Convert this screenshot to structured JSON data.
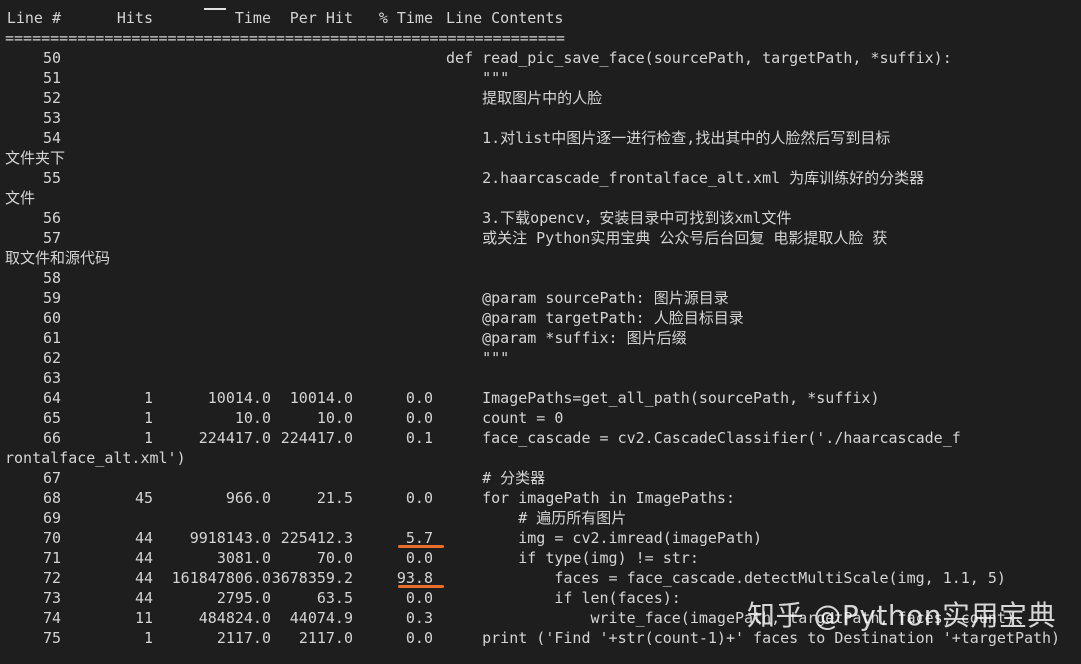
{
  "header": {
    "line_no": "Line #",
    "hits": "Hits",
    "time": "Time",
    "per_hit": "Per Hit",
    "pct_time": "% Time",
    "contents": "Line Contents"
  },
  "separator": "==============================================================",
  "rows": [
    {
      "ln": "50",
      "hits": "",
      "time": "",
      "per_hit": "",
      "pct": "",
      "content": "def read_pic_save_face(sourcePath, targetPath, *suffix):",
      "wrap": ""
    },
    {
      "ln": "51",
      "hits": "",
      "time": "",
      "per_hit": "",
      "pct": "",
      "content": "    \"\"\"",
      "wrap": ""
    },
    {
      "ln": "52",
      "hits": "",
      "time": "",
      "per_hit": "",
      "pct": "",
      "content": "    提取图片中的人脸",
      "wrap": ""
    },
    {
      "ln": "53",
      "hits": "",
      "time": "",
      "per_hit": "",
      "pct": "",
      "content": "",
      "wrap": ""
    },
    {
      "ln": "54",
      "hits": "",
      "time": "",
      "per_hit": "",
      "pct": "",
      "content": "    1.对list中图片逐一进行检查,找出其中的人脸然后写到目标",
      "wrap": "文件夹下"
    },
    {
      "ln": "55",
      "hits": "",
      "time": "",
      "per_hit": "",
      "pct": "",
      "content": "    2.haarcascade_frontalface_alt.xml 为库训练好的分类器",
      "wrap": "文件"
    },
    {
      "ln": "56",
      "hits": "",
      "time": "",
      "per_hit": "",
      "pct": "",
      "content": "    3.下载opencv，安装目录中可找到该xml文件",
      "wrap": ""
    },
    {
      "ln": "57",
      "hits": "",
      "time": "",
      "per_hit": "",
      "pct": "",
      "content": "    或关注 Python实用宝典 公众号后台回复 电影提取人脸 获",
      "wrap": "取文件和源代码"
    },
    {
      "ln": "58",
      "hits": "",
      "time": "",
      "per_hit": "",
      "pct": "",
      "content": "",
      "wrap": ""
    },
    {
      "ln": "59",
      "hits": "",
      "time": "",
      "per_hit": "",
      "pct": "",
      "content": "    @param sourcePath: 图片源目录",
      "wrap": ""
    },
    {
      "ln": "60",
      "hits": "",
      "time": "",
      "per_hit": "",
      "pct": "",
      "content": "    @param targetPath: 人脸目标目录",
      "wrap": ""
    },
    {
      "ln": "61",
      "hits": "",
      "time": "",
      "per_hit": "",
      "pct": "",
      "content": "    @param *suffix: 图片后缀",
      "wrap": ""
    },
    {
      "ln": "62",
      "hits": "",
      "time": "",
      "per_hit": "",
      "pct": "",
      "content": "    \"\"\"",
      "wrap": ""
    },
    {
      "ln": "63",
      "hits": "",
      "time": "",
      "per_hit": "",
      "pct": "",
      "content": "",
      "wrap": ""
    },
    {
      "ln": "64",
      "hits": "1",
      "time": "10014.0",
      "per_hit": "10014.0",
      "pct": "0.0",
      "content": "    ImagePaths=get_all_path(sourcePath, *suffix)",
      "wrap": ""
    },
    {
      "ln": "65",
      "hits": "1",
      "time": "10.0",
      "per_hit": "10.0",
      "pct": "0.0",
      "content": "    count = 0",
      "wrap": ""
    },
    {
      "ln": "66",
      "hits": "1",
      "time": "224417.0",
      "per_hit": "224417.0",
      "pct": "0.1",
      "content": "    face_cascade = cv2.CascadeClassifier('./haarcascade_f",
      "wrap": "rontalface_alt.xml')"
    },
    {
      "ln": "67",
      "hits": "",
      "time": "",
      "per_hit": "",
      "pct": "",
      "content": "    # 分类器",
      "wrap": ""
    },
    {
      "ln": "68",
      "hits": "45",
      "time": "966.0",
      "per_hit": "21.5",
      "pct": "0.0",
      "content": "    for imagePath in ImagePaths:",
      "wrap": ""
    },
    {
      "ln": "69",
      "hits": "",
      "time": "",
      "per_hit": "",
      "pct": "",
      "content": "        # 遍历所有图片",
      "wrap": ""
    },
    {
      "ln": "70",
      "hits": "44",
      "time": "9918143.0",
      "per_hit": "225412.3",
      "pct": "5.7",
      "content": "        img = cv2.imread(imagePath)",
      "wrap": ""
    },
    {
      "ln": "71",
      "hits": "44",
      "time": "3081.0",
      "per_hit": "70.0",
      "pct": "0.0",
      "content": "        if type(img) != str:",
      "wrap": ""
    },
    {
      "ln": "72",
      "hits": "44",
      "time": "161847806.0",
      "per_hit": "3678359.2",
      "pct": "93.8",
      "content": "            faces = face_cascade.detectMultiScale(img, 1.1, 5)",
      "wrap": ""
    },
    {
      "ln": "73",
      "hits": "44",
      "time": "2795.0",
      "per_hit": "63.5",
      "pct": "0.0",
      "content": "            if len(faces):",
      "wrap": ""
    },
    {
      "ln": "74",
      "hits": "11",
      "time": "484824.0",
      "per_hit": "44074.9",
      "pct": "0.3",
      "content": "                write_face(imagePath, targetPath, faces, count)",
      "wrap": ""
    },
    {
      "ln": "75",
      "hits": "1",
      "time": "2117.0",
      "per_hit": "2117.0",
      "pct": "0.0",
      "content": "    print ('Find '+str(count-1)+' faces to Destination '+targetPath)",
      "wrap": ""
    }
  ],
  "highlights": [
    "70",
    "72"
  ],
  "watermark": "知乎 @Python实用宝典",
  "colors": {
    "background": "#1e1e1e",
    "text": "#d4d4d4",
    "highlight_underline": "#e8702a"
  }
}
